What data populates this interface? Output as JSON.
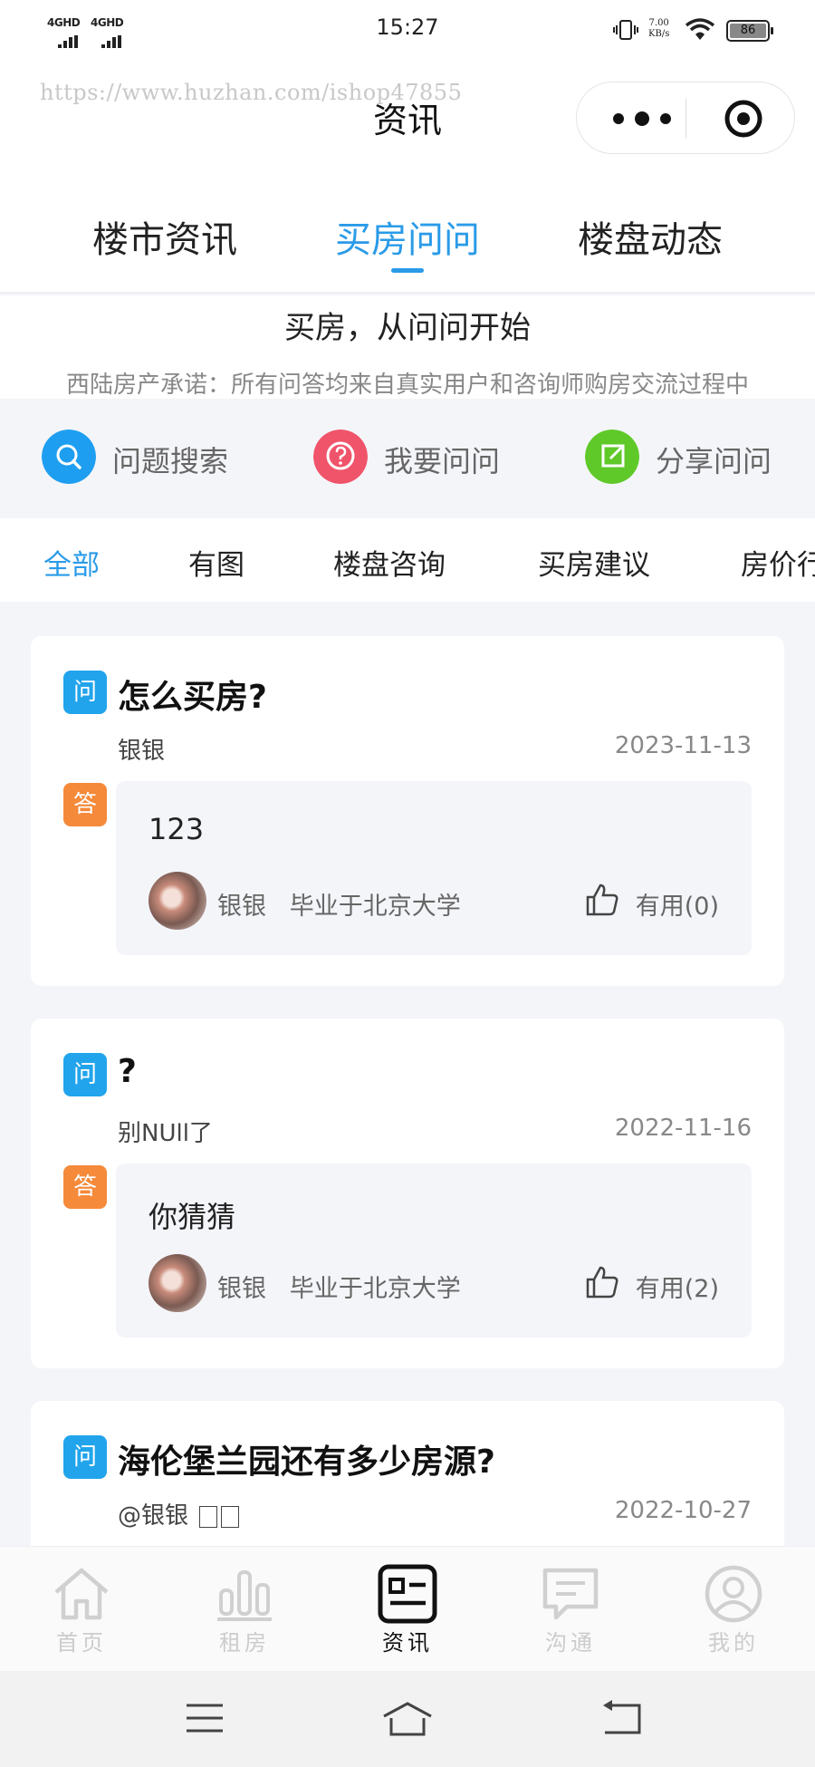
{
  "status_bar": {
    "network_1": "4GHD",
    "network_2": "4GHD",
    "time": "15:27",
    "speed_value": "7.00",
    "speed_unit": "KB/s",
    "battery": "86"
  },
  "header": {
    "watermark": "https://www.huzhan.com/ishop47855",
    "title": "资讯",
    "menu_icon": "more-dots-icon",
    "close_icon": "target-icon"
  },
  "tabs": [
    {
      "label": "楼市资讯",
      "active": false
    },
    {
      "label": "买房问问",
      "active": true
    },
    {
      "label": "楼盘动态",
      "active": false
    }
  ],
  "hero": {
    "title": "买房，从问问开始",
    "subtitle": "西陆房产承诺：所有问答均来自真实用户和咨询师购房交流过程中"
  },
  "actions": [
    {
      "label": "问题搜索",
      "icon": "search-icon",
      "color": "#1e9ef0"
    },
    {
      "label": "我要问问",
      "icon": "question-icon",
      "color": "#f0546a"
    },
    {
      "label": "分享问问",
      "icon": "share-icon",
      "color": "#5fc92a"
    }
  ],
  "categories": [
    {
      "label": "全部",
      "active": true
    },
    {
      "label": "有图",
      "active": false
    },
    {
      "label": "楼盘咨询",
      "active": false
    },
    {
      "label": "买房建议",
      "active": false
    },
    {
      "label": "房价行情",
      "active": false
    }
  ],
  "questions": [
    {
      "q_badge": "问",
      "title": "怎么买房?",
      "asker": "银银",
      "date": "2023-11-13",
      "a_badge": "答",
      "answer": "123",
      "answerer": "银银",
      "answerer_title": "毕业于北京大学",
      "useful": "有用(0)"
    },
    {
      "q_badge": "问",
      "title": "?",
      "asker": "别NUll了",
      "date": "2022-11-16",
      "a_badge": "答",
      "answer": "你猜猜",
      "answerer": "银银",
      "answerer_title": "毕业于北京大学",
      "useful": "有用(2)"
    },
    {
      "q_badge": "问",
      "title": "海伦堡兰园还有多少房源?",
      "asker": "@银银 ",
      "date": "2022-10-27"
    }
  ],
  "bottom_nav": [
    {
      "label": "首页",
      "icon": "home-icon",
      "active": false
    },
    {
      "label": "租房",
      "icon": "bar-chart-icon",
      "active": false
    },
    {
      "label": "资讯",
      "icon": "news-icon",
      "active": true
    },
    {
      "label": "沟通",
      "icon": "chat-icon",
      "active": false
    },
    {
      "label": "我的",
      "icon": "user-icon",
      "active": false
    }
  ],
  "system_nav": [
    "menu-icon",
    "home-outline-icon",
    "back-icon"
  ]
}
